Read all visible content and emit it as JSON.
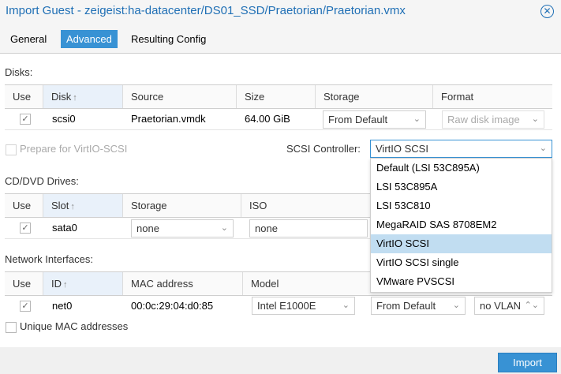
{
  "window": {
    "title": "Import Guest - zeigeist:ha-datacenter/DS01_SSD/Praetorian/Praetorian.vmx",
    "close_glyph": "✕"
  },
  "tabs": [
    {
      "label": "General"
    },
    {
      "label": "Advanced",
      "active": true
    },
    {
      "label": "Resulting Config"
    }
  ],
  "disks": {
    "section_label": "Disks:",
    "columns": [
      "Use",
      "Disk",
      "Source",
      "Size",
      "Storage",
      "Format"
    ],
    "sort_glyph": "↑",
    "row": {
      "use_check": "✓",
      "disk": "scsi0",
      "source": "Praetorian.vmdk",
      "size": "64.00 GiB",
      "storage": "From Default",
      "format": "Raw disk image"
    }
  },
  "prepare_virtio": {
    "label": "Prepare for VirtIO-SCSI"
  },
  "scsi_controller": {
    "label": "SCSI Controller:",
    "value": "VirtIO SCSI",
    "options": [
      "Default (LSI 53C895A)",
      "LSI 53C895A",
      "LSI 53C810",
      "MegaRAID SAS 8708EM2",
      "VirtIO SCSI",
      "VirtIO SCSI single",
      "VMware PVSCSI"
    ],
    "selected_index": 4
  },
  "cd_drives": {
    "section_label": "CD/DVD Drives:",
    "columns": [
      "Use",
      "Slot",
      "Storage",
      "ISO"
    ],
    "row": {
      "use_check": "✓",
      "slot": "sata0",
      "storage": "none",
      "iso": "none"
    }
  },
  "network": {
    "section_label": "Network Interfaces:",
    "columns": [
      "Use",
      "ID",
      "MAC address",
      "Model"
    ],
    "row": {
      "use_check": "✓",
      "id": "net0",
      "mac": "00:0c:29:04:d0:85",
      "model": "Intel E1000E",
      "bridge": "From Default",
      "vlan": "no VLAN"
    }
  },
  "unique_mac": {
    "label": "Unique MAC addresses"
  },
  "footer": {
    "import_label": "Import"
  },
  "glyphs": {
    "chevron_down": "⌄",
    "spinner": "⌃⌄"
  }
}
